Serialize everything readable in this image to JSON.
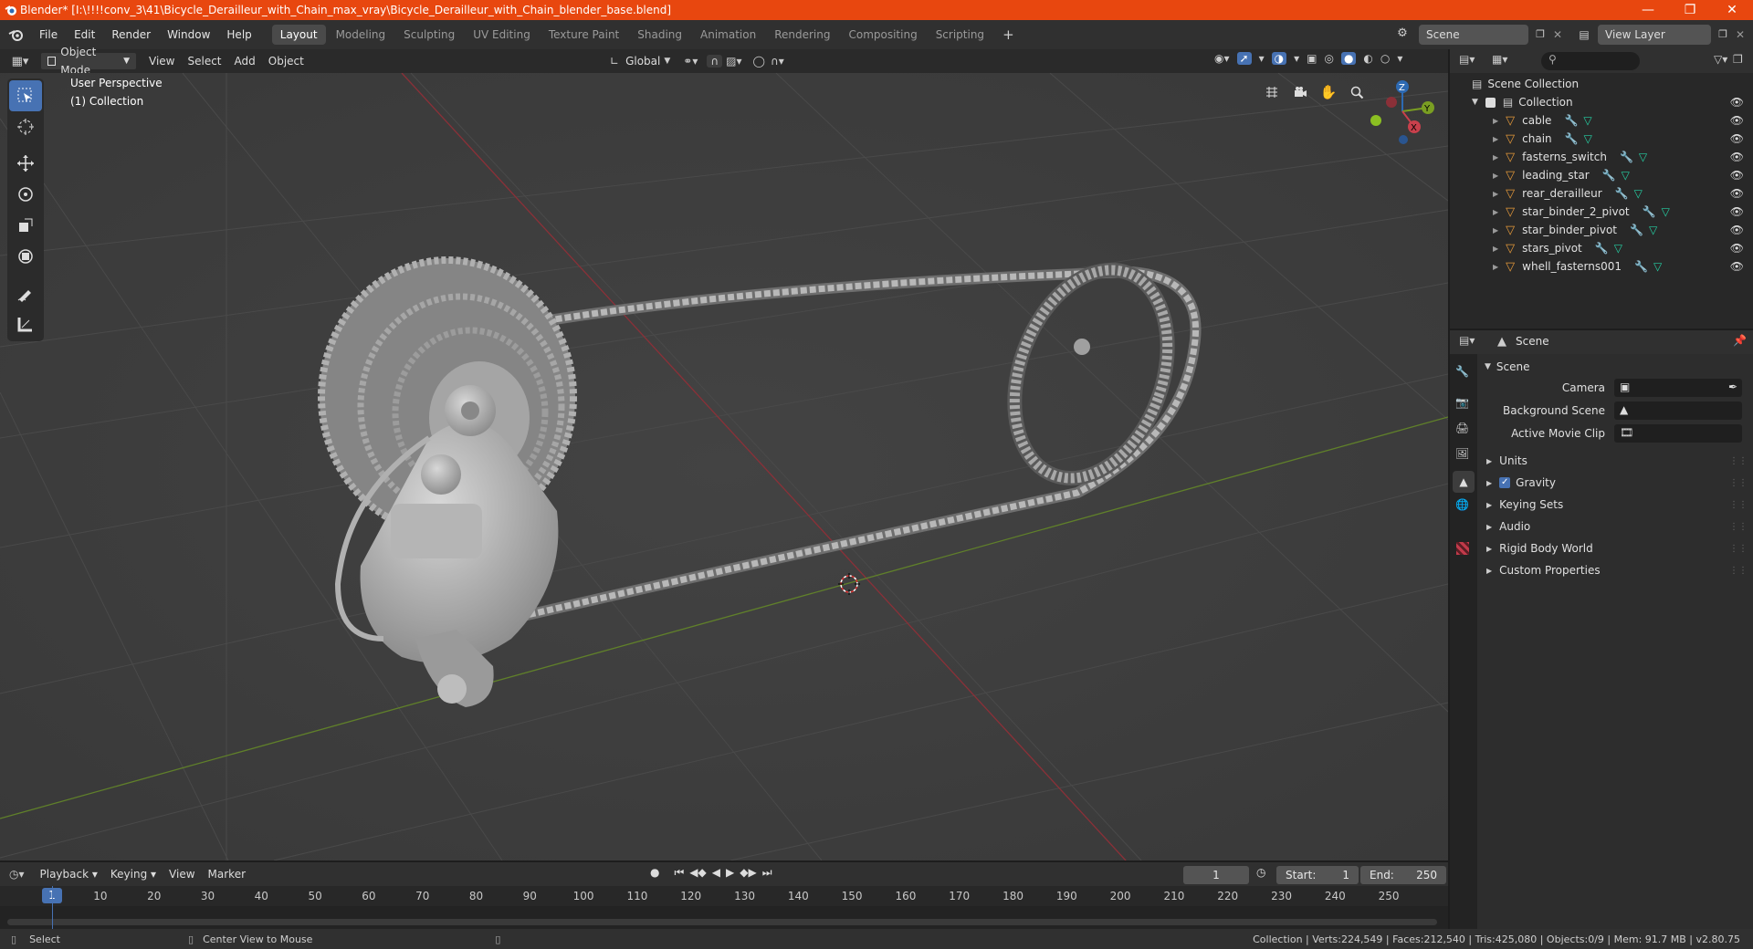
{
  "window": {
    "title": "Blender* [I:\\!!!!conv_3\\41\\Bicycle_Derailleur_with_Chain_max_vray\\Bicycle_Derailleur_with_Chain_blender_base.blend]",
    "minimize_icon": "minimize-icon",
    "maximize_icon": "restore-icon",
    "close_icon": "close-icon"
  },
  "menubar": {
    "items": [
      "File",
      "Edit",
      "Render",
      "Window",
      "Help"
    ],
    "workspaces": [
      "Layout",
      "Modeling",
      "Sculpting",
      "UV Editing",
      "Texture Paint",
      "Shading",
      "Animation",
      "Rendering",
      "Compositing",
      "Scripting"
    ],
    "active_workspace": "Layout",
    "scene": "Scene",
    "view_layer": "View Layer"
  },
  "viewport_header": {
    "mode": "Object Mode",
    "menus": [
      "View",
      "Select",
      "Add",
      "Object"
    ],
    "orientation": "Global"
  },
  "viewport": {
    "perspective": "User Perspective",
    "collection": "(1) Collection",
    "axis_labels": [
      "Z",
      "Y",
      "X"
    ]
  },
  "outliner": {
    "root": "Scene Collection",
    "collection": "Collection",
    "objects": [
      "cable",
      "chain",
      "fasterns_switch",
      "leading_star",
      "rear_derailleur",
      "star_binder_2_pivot",
      "star_binder_pivot",
      "stars_pivot",
      "whell_fasterns001"
    ]
  },
  "properties": {
    "context": "Scene",
    "section": "Scene",
    "fields": [
      {
        "label": "Camera",
        "value": ""
      },
      {
        "label": "Background Scene",
        "value": ""
      },
      {
        "label": "Active Movie Clip",
        "value": ""
      }
    ],
    "panels": [
      "Units",
      "Gravity",
      "Keying Sets",
      "Audio",
      "Rigid Body World",
      "Custom Properties"
    ],
    "gravity_enabled": true
  },
  "timeline": {
    "menus": [
      "Playback",
      "Keying",
      "View",
      "Marker"
    ],
    "current_frame": "1",
    "start_label": "Start:",
    "start": "1",
    "end_label": "End:",
    "end": "250",
    "ticks": [
      "1",
      "10",
      "20",
      "30",
      "40",
      "50",
      "60",
      "70",
      "80",
      "90",
      "100",
      "110",
      "120",
      "130",
      "140",
      "150",
      "160",
      "170",
      "180",
      "190",
      "200",
      "210",
      "220",
      "230",
      "240",
      "250"
    ]
  },
  "statusbar": {
    "left": "Select",
    "middle": "Center View to Mouse",
    "right": "Collection | Verts:224,549 | Faces:212,540 | Tris:425,080 | Objects:0/9 | Mem: 91.7 MB | v2.80.75"
  },
  "colors": {
    "title_bar": "#e8470f",
    "accent_blue": "#4772b3",
    "x_axis": "#c8404c",
    "y_axis": "#7a9e22",
    "object_orange": "#e69a3a"
  }
}
